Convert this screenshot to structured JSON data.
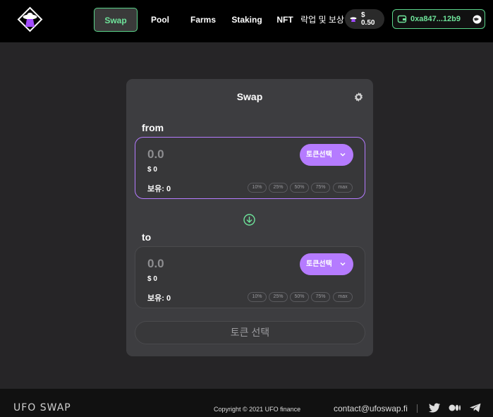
{
  "header": {
    "nav": {
      "swap": "Swap",
      "pool": "Pool",
      "farms": "Farms",
      "staking": "Staking",
      "nft": "NFT",
      "rewards": "락업 및 보상"
    },
    "price": {
      "line1": "$",
      "line2": "0.50"
    },
    "wallet": {
      "address": "0xa847...12b9"
    }
  },
  "swap_card": {
    "title": "Swap",
    "from": {
      "label": "from",
      "amount_placeholder": "0.0",
      "usd": "$ 0",
      "balance": "보유: 0",
      "token_button": "토큰선택"
    },
    "to": {
      "label": "to",
      "amount_placeholder": "0.0",
      "usd": "$ 0",
      "balance": "보유: 0",
      "token_button": "토큰선택"
    },
    "percent_options": [
      "10%",
      "25%",
      "50%",
      "75%",
      "max"
    ],
    "submit_label": "토큰 선택"
  },
  "footer": {
    "logo": "UFO SWAP",
    "copyright": "Copyright © 2021 UFO finance",
    "contact": "contact@ufoswap.fi"
  },
  "colors": {
    "accent_green": "#6ee39a",
    "accent_purple": "#b57bff",
    "card_bg": "#3d3d40",
    "page_bg": "#262527"
  },
  "icons": [
    "logo-icon",
    "coin-icon",
    "wallet-icon",
    "globe-icon",
    "gear-icon",
    "chevron-down-icon",
    "arrow-down-circle-icon",
    "twitter-icon",
    "medium-icon",
    "telegram-icon"
  ]
}
